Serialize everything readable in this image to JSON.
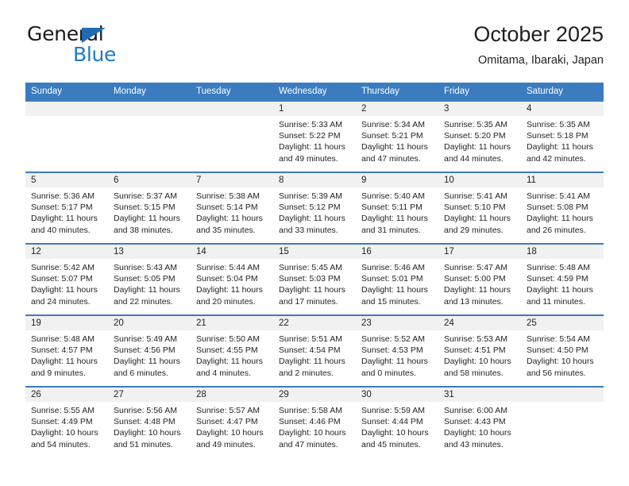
{
  "logo": {
    "word_one": "General",
    "word_two": "Blue",
    "triangle_color": "#1f6cb0",
    "blue_color": "#1f7ac4"
  },
  "header": {
    "title": "October 2025",
    "subtitle": "Omitama, Ibaraki, Japan"
  },
  "theme": {
    "header_blue": "#3a7cbf",
    "daynum_bg": "#f1f1f1",
    "text": "#231f20"
  },
  "weekday_headers": [
    "Sunday",
    "Monday",
    "Tuesday",
    "Wednesday",
    "Thursday",
    "Friday",
    "Saturday"
  ],
  "weeks": [
    [
      {
        "day": "",
        "lines": []
      },
      {
        "day": "",
        "lines": []
      },
      {
        "day": "",
        "lines": []
      },
      {
        "day": "1",
        "lines": [
          "Sunrise: 5:33 AM",
          "Sunset: 5:22 PM",
          "Daylight: 11 hours",
          "and 49 minutes."
        ]
      },
      {
        "day": "2",
        "lines": [
          "Sunrise: 5:34 AM",
          "Sunset: 5:21 PM",
          "Daylight: 11 hours",
          "and 47 minutes."
        ]
      },
      {
        "day": "3",
        "lines": [
          "Sunrise: 5:35 AM",
          "Sunset: 5:20 PM",
          "Daylight: 11 hours",
          "and 44 minutes."
        ]
      },
      {
        "day": "4",
        "lines": [
          "Sunrise: 5:35 AM",
          "Sunset: 5:18 PM",
          "Daylight: 11 hours",
          "and 42 minutes."
        ]
      }
    ],
    [
      {
        "day": "5",
        "lines": [
          "Sunrise: 5:36 AM",
          "Sunset: 5:17 PM",
          "Daylight: 11 hours",
          "and 40 minutes."
        ]
      },
      {
        "day": "6",
        "lines": [
          "Sunrise: 5:37 AM",
          "Sunset: 5:15 PM",
          "Daylight: 11 hours",
          "and 38 minutes."
        ]
      },
      {
        "day": "7",
        "lines": [
          "Sunrise: 5:38 AM",
          "Sunset: 5:14 PM",
          "Daylight: 11 hours",
          "and 35 minutes."
        ]
      },
      {
        "day": "8",
        "lines": [
          "Sunrise: 5:39 AM",
          "Sunset: 5:12 PM",
          "Daylight: 11 hours",
          "and 33 minutes."
        ]
      },
      {
        "day": "9",
        "lines": [
          "Sunrise: 5:40 AM",
          "Sunset: 5:11 PM",
          "Daylight: 11 hours",
          "and 31 minutes."
        ]
      },
      {
        "day": "10",
        "lines": [
          "Sunrise: 5:41 AM",
          "Sunset: 5:10 PM",
          "Daylight: 11 hours",
          "and 29 minutes."
        ]
      },
      {
        "day": "11",
        "lines": [
          "Sunrise: 5:41 AM",
          "Sunset: 5:08 PM",
          "Daylight: 11 hours",
          "and 26 minutes."
        ]
      }
    ],
    [
      {
        "day": "12",
        "lines": [
          "Sunrise: 5:42 AM",
          "Sunset: 5:07 PM",
          "Daylight: 11 hours",
          "and 24 minutes."
        ]
      },
      {
        "day": "13",
        "lines": [
          "Sunrise: 5:43 AM",
          "Sunset: 5:05 PM",
          "Daylight: 11 hours",
          "and 22 minutes."
        ]
      },
      {
        "day": "14",
        "lines": [
          "Sunrise: 5:44 AM",
          "Sunset: 5:04 PM",
          "Daylight: 11 hours",
          "and 20 minutes."
        ]
      },
      {
        "day": "15",
        "lines": [
          "Sunrise: 5:45 AM",
          "Sunset: 5:03 PM",
          "Daylight: 11 hours",
          "and 17 minutes."
        ]
      },
      {
        "day": "16",
        "lines": [
          "Sunrise: 5:46 AM",
          "Sunset: 5:01 PM",
          "Daylight: 11 hours",
          "and 15 minutes."
        ]
      },
      {
        "day": "17",
        "lines": [
          "Sunrise: 5:47 AM",
          "Sunset: 5:00 PM",
          "Daylight: 11 hours",
          "and 13 minutes."
        ]
      },
      {
        "day": "18",
        "lines": [
          "Sunrise: 5:48 AM",
          "Sunset: 4:59 PM",
          "Daylight: 11 hours",
          "and 11 minutes."
        ]
      }
    ],
    [
      {
        "day": "19",
        "lines": [
          "Sunrise: 5:48 AM",
          "Sunset: 4:57 PM",
          "Daylight: 11 hours",
          "and 9 minutes."
        ]
      },
      {
        "day": "20",
        "lines": [
          "Sunrise: 5:49 AM",
          "Sunset: 4:56 PM",
          "Daylight: 11 hours",
          "and 6 minutes."
        ]
      },
      {
        "day": "21",
        "lines": [
          "Sunrise: 5:50 AM",
          "Sunset: 4:55 PM",
          "Daylight: 11 hours",
          "and 4 minutes."
        ]
      },
      {
        "day": "22",
        "lines": [
          "Sunrise: 5:51 AM",
          "Sunset: 4:54 PM",
          "Daylight: 11 hours",
          "and 2 minutes."
        ]
      },
      {
        "day": "23",
        "lines": [
          "Sunrise: 5:52 AM",
          "Sunset: 4:53 PM",
          "Daylight: 11 hours",
          "and 0 minutes."
        ]
      },
      {
        "day": "24",
        "lines": [
          "Sunrise: 5:53 AM",
          "Sunset: 4:51 PM",
          "Daylight: 10 hours",
          "and 58 minutes."
        ]
      },
      {
        "day": "25",
        "lines": [
          "Sunrise: 5:54 AM",
          "Sunset: 4:50 PM",
          "Daylight: 10 hours",
          "and 56 minutes."
        ]
      }
    ],
    [
      {
        "day": "26",
        "lines": [
          "Sunrise: 5:55 AM",
          "Sunset: 4:49 PM",
          "Daylight: 10 hours",
          "and 54 minutes."
        ]
      },
      {
        "day": "27",
        "lines": [
          "Sunrise: 5:56 AM",
          "Sunset: 4:48 PM",
          "Daylight: 10 hours",
          "and 51 minutes."
        ]
      },
      {
        "day": "28",
        "lines": [
          "Sunrise: 5:57 AM",
          "Sunset: 4:47 PM",
          "Daylight: 10 hours",
          "and 49 minutes."
        ]
      },
      {
        "day": "29",
        "lines": [
          "Sunrise: 5:58 AM",
          "Sunset: 4:46 PM",
          "Daylight: 10 hours",
          "and 47 minutes."
        ]
      },
      {
        "day": "30",
        "lines": [
          "Sunrise: 5:59 AM",
          "Sunset: 4:44 PM",
          "Daylight: 10 hours",
          "and 45 minutes."
        ]
      },
      {
        "day": "31",
        "lines": [
          "Sunrise: 6:00 AM",
          "Sunset: 4:43 PM",
          "Daylight: 10 hours",
          "and 43 minutes."
        ]
      },
      {
        "day": "",
        "lines": []
      }
    ]
  ]
}
